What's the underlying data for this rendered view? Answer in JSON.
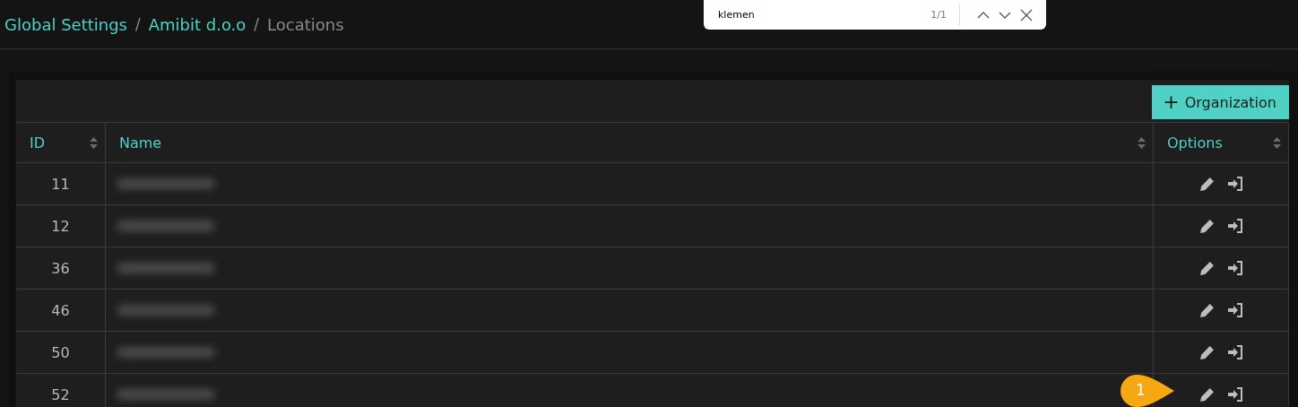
{
  "breadcrumb": [
    {
      "label": "Global Settings",
      "kind": "link"
    },
    {
      "label": "Amibit d.o.o",
      "kind": "link"
    },
    {
      "label": "Locations",
      "kind": "current"
    }
  ],
  "breadcrumb_separator": "/",
  "find_bar": {
    "value": "klemen",
    "count": "1/1"
  },
  "add_button": {
    "label": "Organization",
    "icon": "+"
  },
  "table": {
    "columns": [
      {
        "label": "ID",
        "sortable": true
      },
      {
        "label": "Name",
        "sortable": true
      },
      {
        "label": "Options",
        "sortable": true
      }
    ],
    "rows": [
      {
        "id": "11",
        "name_blurred": true
      },
      {
        "id": "12",
        "name_blurred": true
      },
      {
        "id": "36",
        "name_blurred": true
      },
      {
        "id": "46",
        "name_blurred": true
      },
      {
        "id": "50",
        "name_blurred": true
      },
      {
        "id": "52",
        "name_blurred": true
      }
    ]
  },
  "callout": {
    "label": "1"
  }
}
